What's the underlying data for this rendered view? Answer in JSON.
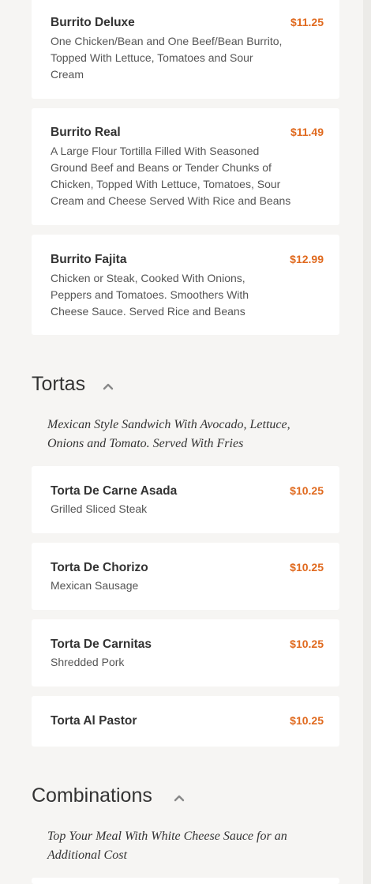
{
  "burritos": {
    "items": [
      {
        "name": "Burrito Deluxe",
        "price": "$11.25",
        "desc": "One Chicken/Bean and One Beef/Bean Burrito, Topped With Lettuce, Tomatoes and Sour Cream"
      },
      {
        "name": "Burrito Real",
        "price": "$11.49",
        "desc": "A Large Flour Tortilla Filled With Seasoned Ground Beef and Beans or Tender Chunks of Chicken, Topped With Lettuce, Tomatoes, Sour Cream and Cheese Served With Rice and Beans"
      },
      {
        "name": "Burrito Fajita",
        "price": "$12.99",
        "desc": "Chicken or Steak, Cooked With Onions, Peppers and Tomatoes. Smoothers With Cheese Sauce. Served Rice and Beans"
      }
    ]
  },
  "tortas": {
    "title": "Tortas",
    "note": "Mexican Style Sandwich With Avocado, Lettuce, Onions and Tomato. Served With Fries",
    "items": [
      {
        "name": "Torta De Carne Asada",
        "price": "$10.25",
        "desc": "Grilled Sliced Steak"
      },
      {
        "name": "Torta De Chorizo",
        "price": "$10.25",
        "desc": "Mexican Sausage"
      },
      {
        "name": "Torta De Carnitas",
        "price": "$10.25",
        "desc": "Shredded Pork"
      },
      {
        "name": "Torta Al Pastor",
        "price": "$10.25"
      }
    ]
  },
  "combinations": {
    "title": "Combinations",
    "note": "Top Your Meal With White Cheese Sauce for an Additional Cost"
  },
  "colors": {
    "price": "#e06a1f",
    "card": "#ffffff",
    "background": "#f6f5f3"
  },
  "icons": {
    "collapse": "chevron-up-icon"
  }
}
